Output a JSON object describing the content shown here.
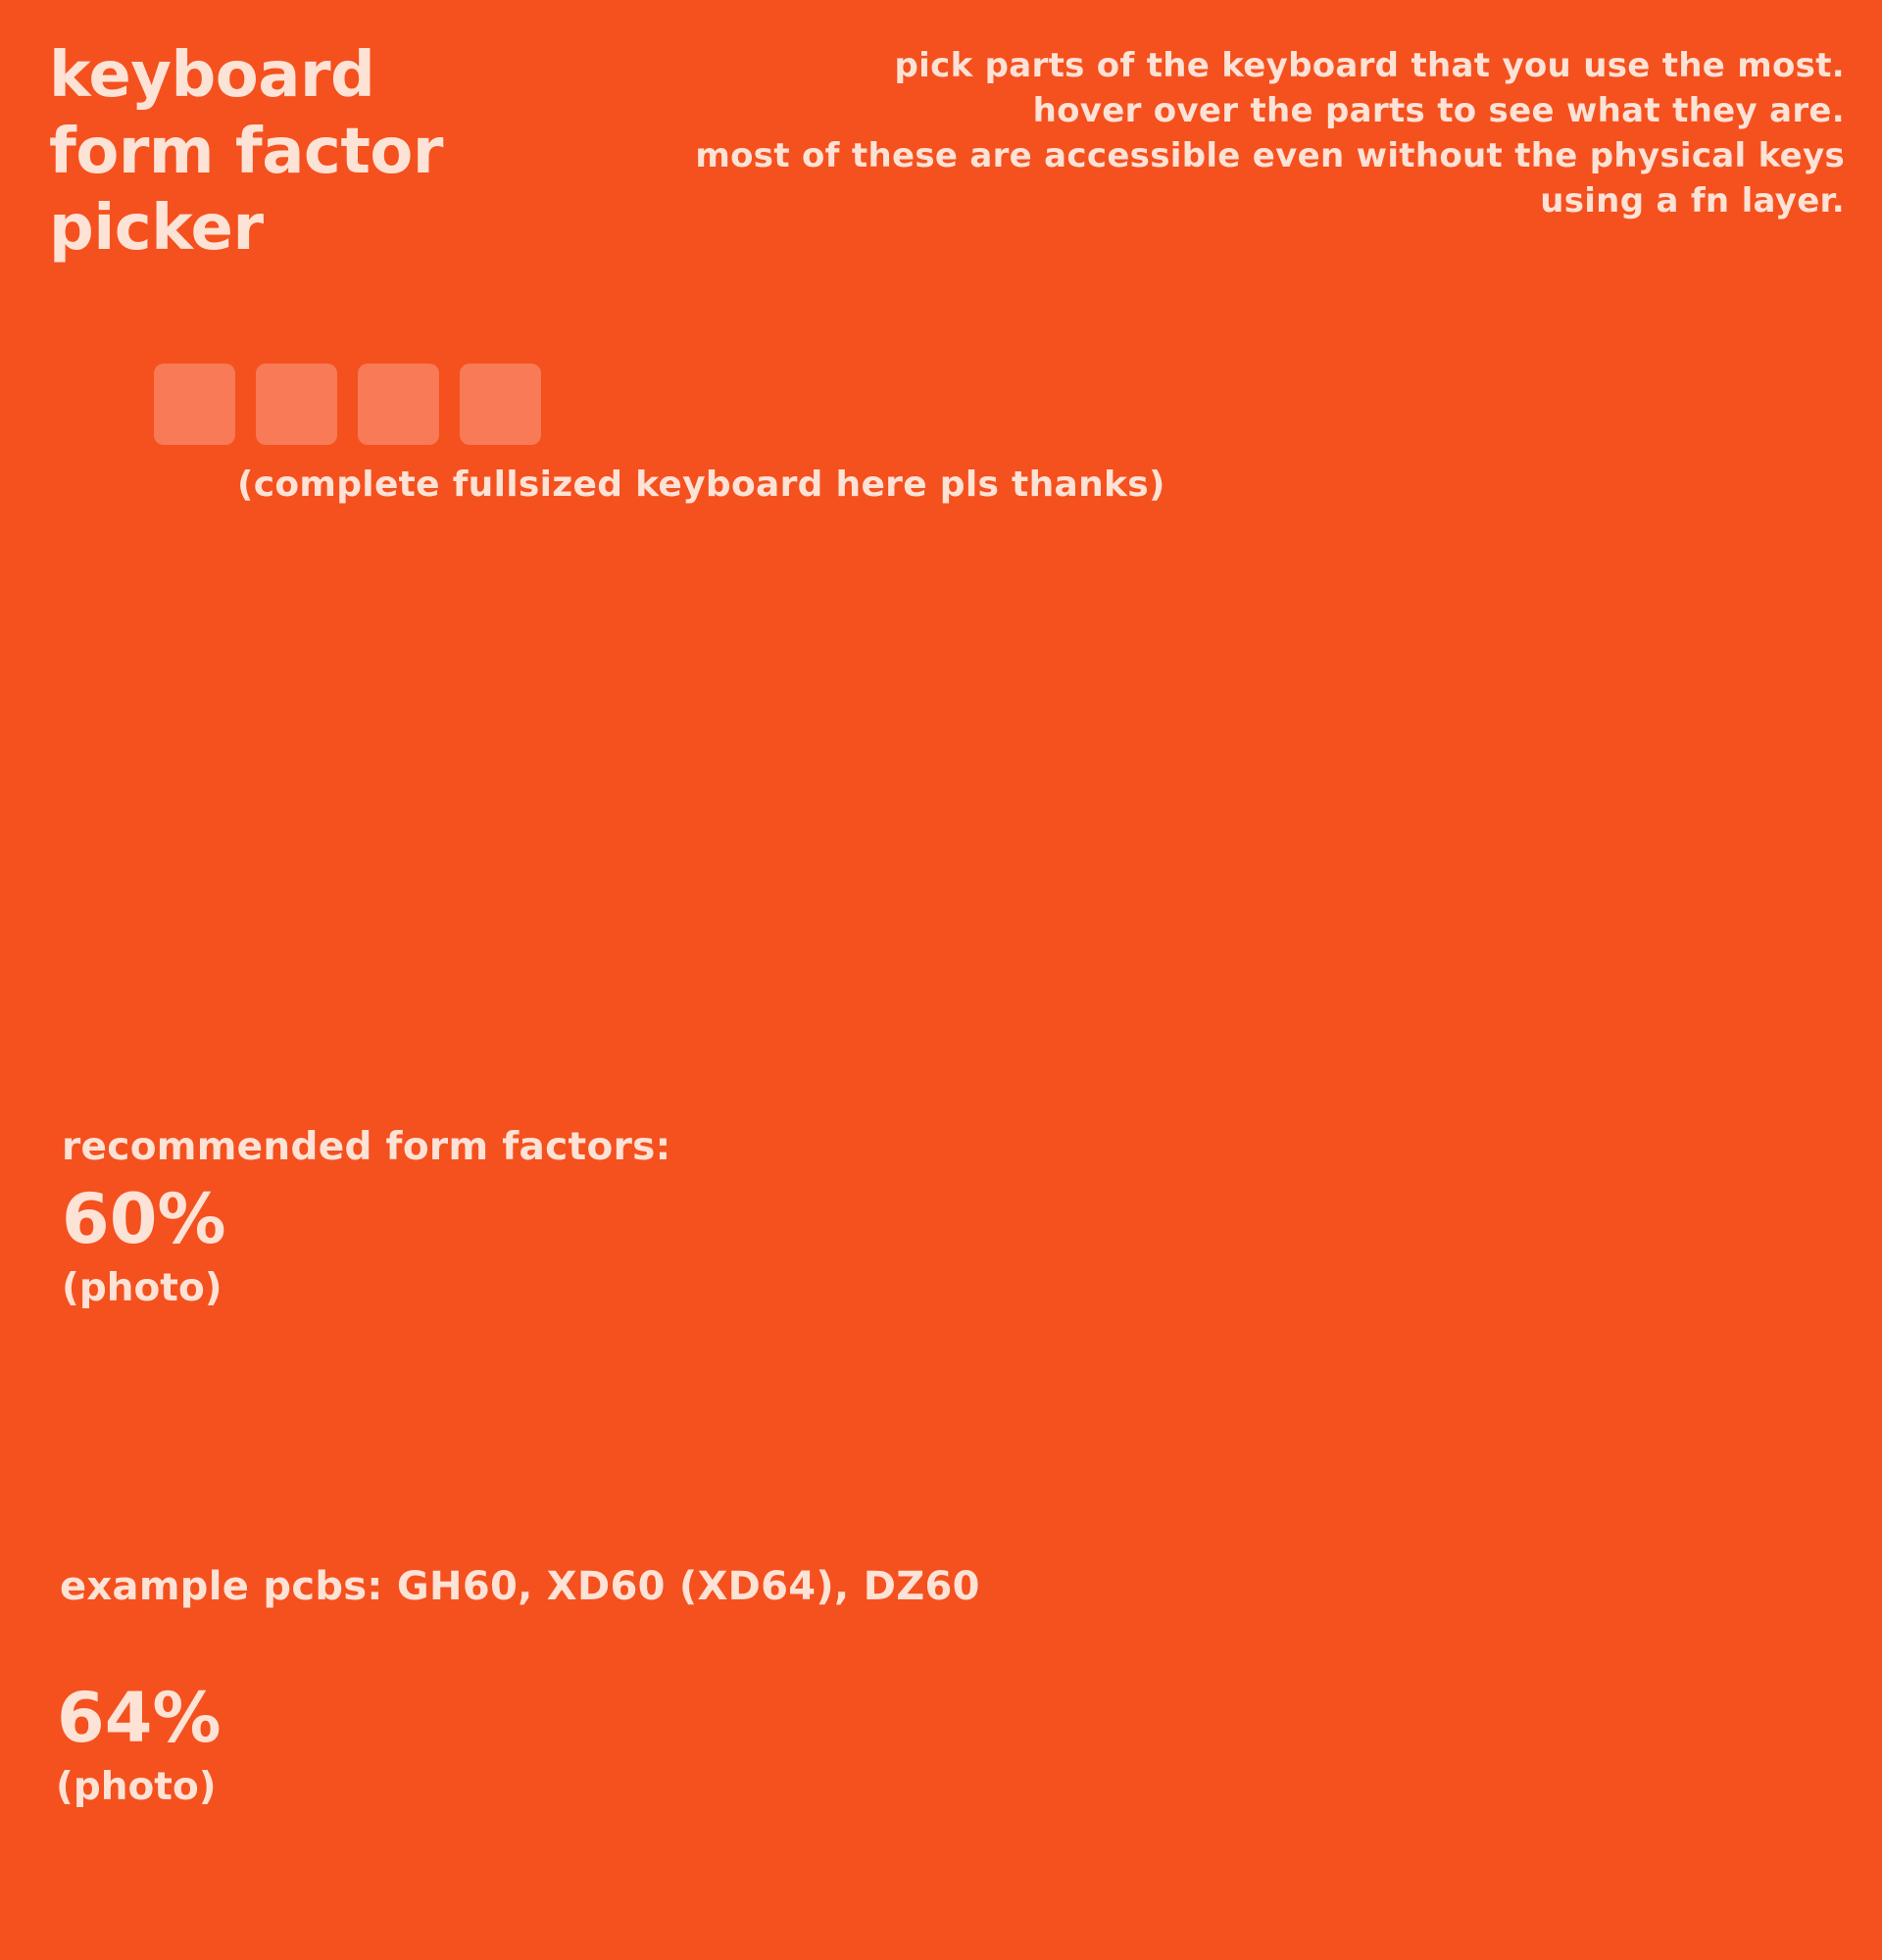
{
  "colors": {
    "background": "#f4511f",
    "text": "#fde2d6",
    "key": "#f87a56"
  },
  "header": {
    "title_lines": [
      "keyboard",
      "form factor",
      "picker"
    ],
    "instructions": [
      "pick parts of the keyboard that you use the most.",
      "hover over the parts to see what they are.",
      "most of these are accessible even without the physical keys",
      "using a fn layer."
    ]
  },
  "keyboard": {
    "key_count": 4,
    "placeholder_note": "(complete fullsized keyboard here pls thanks)"
  },
  "recommendations": {
    "heading": "recommended form factors:",
    "items": [
      {
        "name": "60%",
        "photo_label": "(photo)",
        "pcbs": "example pcbs: GH60, XD60 (XD64), DZ60"
      },
      {
        "name": "64%",
        "photo_label": "(photo)"
      }
    ]
  }
}
